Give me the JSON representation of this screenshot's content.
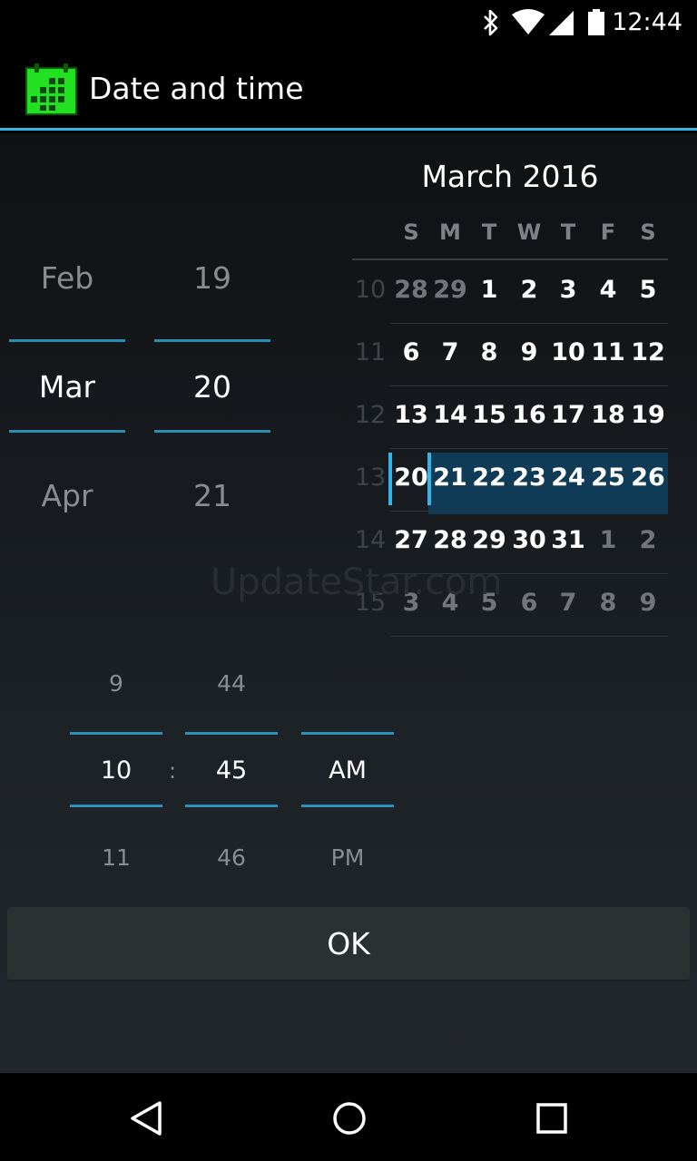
{
  "status_bar": {
    "time": "12:44",
    "icons": [
      "bluetooth-icon",
      "wifi-icon",
      "cell-signal-icon",
      "battery-icon"
    ]
  },
  "app_bar": {
    "title": "Date and time",
    "icon": "calendar-grid-icon",
    "accent_color": "#33b5e5",
    "icon_color": "#22e022"
  },
  "date_picker": {
    "month": {
      "prev": "Feb",
      "current": "Mar",
      "next": "Apr"
    },
    "day": {
      "prev": "19",
      "current": "20",
      "next": "21"
    }
  },
  "calendar": {
    "title": "March 2016",
    "weekdays": [
      "S",
      "M",
      "T",
      "W",
      "T",
      "F",
      "S"
    ],
    "weeks": [
      {
        "num": "10",
        "days": [
          "28",
          "29",
          "1",
          "2",
          "3",
          "4",
          "5"
        ]
      },
      {
        "num": "11",
        "days": [
          "6",
          "7",
          "8",
          "9",
          "10",
          "11",
          "12"
        ]
      },
      {
        "num": "12",
        "days": [
          "13",
          "14",
          "15",
          "16",
          "17",
          "18",
          "19"
        ]
      },
      {
        "num": "13",
        "days": [
          "20",
          "21",
          "22",
          "23",
          "24",
          "25",
          "26"
        ]
      },
      {
        "num": "14",
        "days": [
          "27",
          "28",
          "29",
          "30",
          "31",
          "1",
          "2"
        ]
      },
      {
        "num": "15",
        "days": [
          "3",
          "4",
          "5",
          "6",
          "7",
          "8",
          "9"
        ]
      }
    ],
    "selected_day": "20",
    "highlight_color": "#0f3b57"
  },
  "time_picker": {
    "hour": {
      "prev": "9",
      "current": "10",
      "next": "11"
    },
    "separator": ":",
    "minute": {
      "prev": "44",
      "current": "45",
      "next": "46"
    },
    "ampm": {
      "current": "AM",
      "next": "PM"
    }
  },
  "watermark": "UpdateStar.com",
  "ok_button": "OK",
  "nav_bar": {
    "icons": [
      "back-icon",
      "home-icon",
      "recents-icon"
    ]
  }
}
